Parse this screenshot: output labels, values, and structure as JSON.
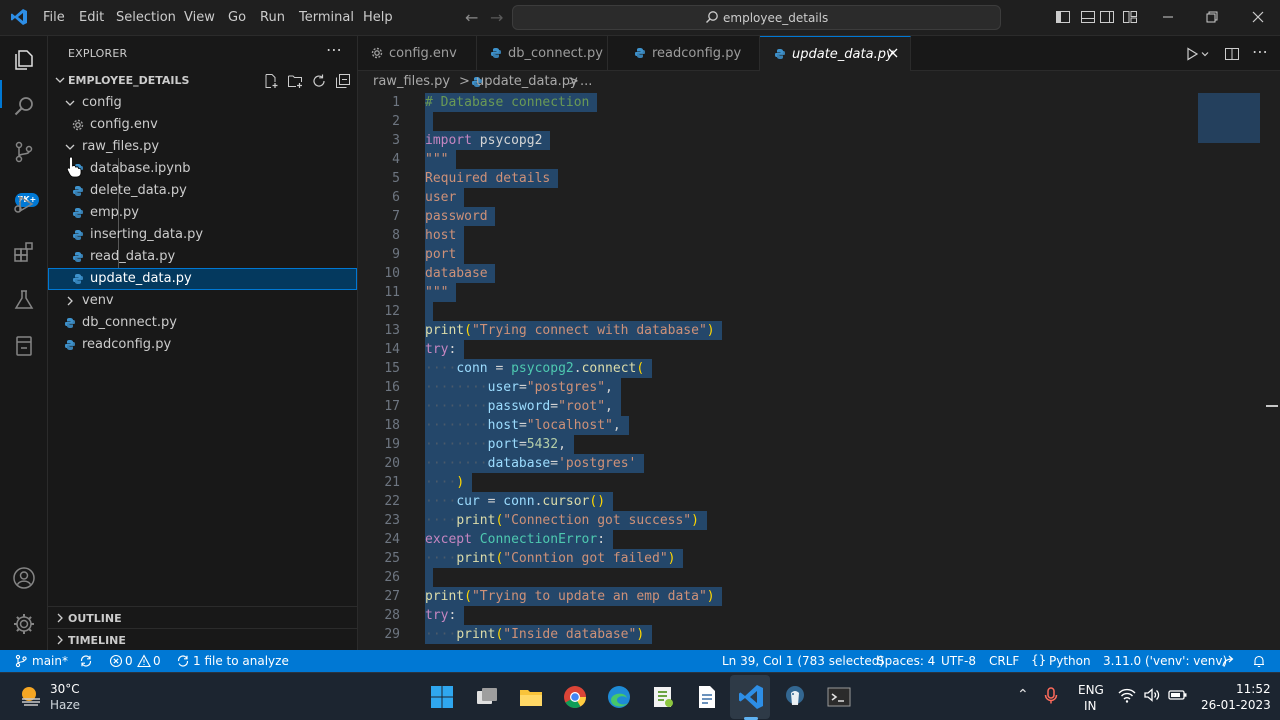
{
  "titlebar": {
    "menu": [
      "File",
      "Edit",
      "Selection",
      "View",
      "Go",
      "Run",
      "Terminal",
      "Help"
    ],
    "search_text": "employee_details"
  },
  "activity": {
    "scm_badge": "7K+"
  },
  "sidebar": {
    "title": "EXPLORER",
    "folder_name": "EMPLOYEE_DETAILS",
    "tree": {
      "config": "config",
      "config_env": "config.env",
      "raw_files": "raw_files.py",
      "database_ipynb": "database.ipynb",
      "delete_data": "delete_data.py",
      "emp": "emp.py",
      "inserting_data": "inserting_data.py",
      "read_data": "read_data.py",
      "update_data": "update_data.py",
      "venv": "venv",
      "db_connect": "db_connect.py",
      "readconfig": "readconfig.py"
    },
    "outline_label": "OUTLINE",
    "timeline_label": "TIMELINE"
  },
  "tabs": [
    {
      "label": "config.env"
    },
    {
      "label": "db_connect.py"
    },
    {
      "label": "readconfig.py"
    },
    {
      "label": "update_data.py"
    }
  ],
  "breadcrumb": {
    "folder": "raw_files.py",
    "sep": ">",
    "file": "update_data.py",
    "more": "..."
  },
  "editor": {
    "line_numbers": [
      "1",
      "2",
      "3",
      "4",
      "5",
      "6",
      "7",
      "8",
      "9",
      "10",
      "11",
      "12",
      "13",
      "14",
      "15",
      "16",
      "17",
      "18",
      "19",
      "20",
      "21",
      "22",
      "23",
      "24",
      "25",
      "26",
      "27",
      "28",
      "29"
    ]
  },
  "statusbar": {
    "branch": "main*",
    "errors": "0",
    "warnings": "0",
    "analyze": "1 file to analyze",
    "position": "Ln 39, Col 1 (783 selected)",
    "spaces": "Spaces: 4",
    "encoding": "UTF-8",
    "eol": "CRLF",
    "language": "Python",
    "interpreter": "3.11.0 ('venv': venv)"
  },
  "taskbar": {
    "temperature": "30°C",
    "weather": "Haze",
    "lang_top": "ENG",
    "lang_bottom": "IN",
    "time": "11:52",
    "date": "26-01-2023"
  },
  "colors": {
    "accent": "#0078d4",
    "statusbar": "#0078d4",
    "selection": "#264f78",
    "editor_bg": "#1f1f1f"
  }
}
